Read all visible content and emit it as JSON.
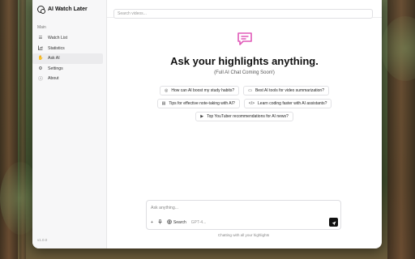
{
  "app": {
    "title": "AI Watch Later",
    "version": "v1.0.0"
  },
  "sidebar": {
    "section_label": "Main",
    "items": [
      {
        "label": "Watch List",
        "icon": "list-icon",
        "active": false
      },
      {
        "label": "Statistics",
        "icon": "chart-icon",
        "active": false
      },
      {
        "label": "Ask AI",
        "icon": "hand-icon",
        "active": true
      },
      {
        "label": "Settings",
        "icon": "gear-icon",
        "active": false
      },
      {
        "label": "About",
        "icon": "info-icon",
        "active": false
      }
    ]
  },
  "search": {
    "placeholder": "Search videos...",
    "value": ""
  },
  "hero": {
    "title": "Ask your highlights anything.",
    "subtitle": "(Full AI Chat Coming Soon!)",
    "icon": "chat-icon",
    "accent": "#e05ab8"
  },
  "suggestions": [
    {
      "label": "How can AI boost my study habits?",
      "icon": "lightbulb-icon"
    },
    {
      "label": "Best AI tools for video summarization?",
      "icon": "monitor-icon"
    },
    {
      "label": "Tips for effective note-taking with AI?",
      "icon": "document-icon"
    },
    {
      "label": "Learn coding faster with AI assistants?",
      "icon": "code-icon"
    },
    {
      "label": "Top YouTuber recommendations for AI news?",
      "icon": "video-icon"
    }
  ],
  "composer": {
    "placeholder": "Ask anything...",
    "attach_label": "+",
    "search_label": "Search",
    "model_label": "GPT-4...",
    "caption": "Chatting with all your highlights"
  }
}
